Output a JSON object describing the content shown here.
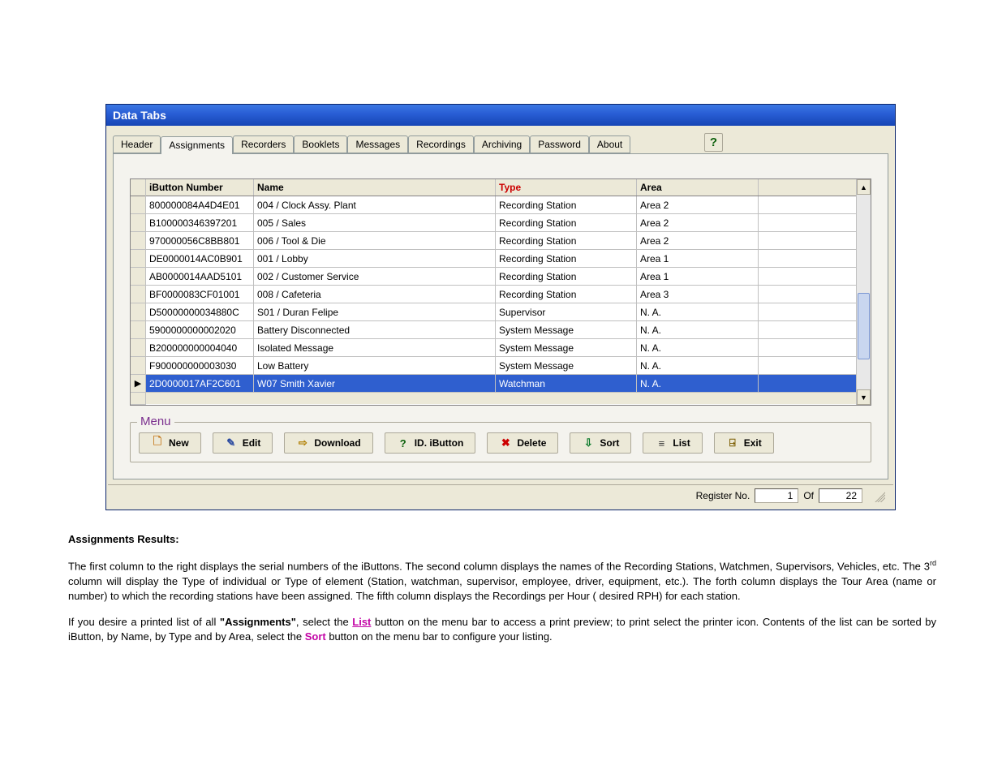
{
  "window": {
    "title": "Data Tabs",
    "help_icon": "?"
  },
  "tabs": {
    "items": [
      "Header",
      "Assignments",
      "Recorders",
      "Booklets",
      "Messages",
      "Recordings",
      "Archiving",
      "Password",
      "About"
    ],
    "active_index": 1
  },
  "grid": {
    "headers": {
      "ibutton": "iButton Number",
      "name": "Name",
      "type": "Type",
      "area": "Area"
    },
    "rows": [
      {
        "ibutton": "800000084A4D4E01",
        "name": "004 / Clock Assy. Plant",
        "type": "Recording Station",
        "area": "Area 2",
        "selected": false
      },
      {
        "ibutton": "B100000346397201",
        "name": "005 / Sales",
        "type": "Recording Station",
        "area": "Area 2",
        "selected": false
      },
      {
        "ibutton": "970000056C8BB801",
        "name": "006 / Tool & Die",
        "type": "Recording Station",
        "area": "Area 2",
        "selected": false
      },
      {
        "ibutton": "DE0000014AC0B901",
        "name": "001 / Lobby",
        "type": "Recording Station",
        "area": "Area 1",
        "selected": false
      },
      {
        "ibutton": "AB0000014AAD5101",
        "name": "002 / Customer Service",
        "type": "Recording Station",
        "area": "Area 1",
        "selected": false
      },
      {
        "ibutton": "BF0000083CF01001",
        "name": "008 / Cafeteria",
        "type": "Recording Station",
        "area": "Area 3",
        "selected": false
      },
      {
        "ibutton": "D50000000034880C",
        "name": "S01 / Duran Felipe",
        "type": "Supervisor",
        "area": "N. A.",
        "selected": false
      },
      {
        "ibutton": "5900000000002020",
        "name": "Battery Disconnected",
        "type": "System Message",
        "area": "N. A.",
        "selected": false
      },
      {
        "ibutton": "B200000000004040",
        "name": "Isolated Message",
        "type": "System Message",
        "area": "N. A.",
        "selected": false
      },
      {
        "ibutton": "F900000000003030",
        "name": "Low Battery",
        "type": "System Message",
        "area": "N. A.",
        "selected": false
      },
      {
        "ibutton": "2D0000017AF2C601",
        "name": "W07 Smith Xavier",
        "type": "Watchman",
        "area": "N. A.",
        "selected": true
      }
    ]
  },
  "menu": {
    "legend": "Menu",
    "buttons": {
      "new": "New",
      "edit": "Edit",
      "download": "Download",
      "id_ibutton": "ID. iButton",
      "delete": "Delete",
      "sort": "Sort",
      "list": "List",
      "exit": "Exit"
    }
  },
  "status": {
    "label": "Register No.",
    "current": "1",
    "of_label": "Of",
    "total": "22"
  },
  "doc": {
    "heading": "Assignments Results:",
    "p1a": "The first column to the right displays the serial numbers of the iButtons. The second column displays the names of the Recording Stations, Watchmen, Supervisors, Vehicles, etc. The 3",
    "p1_sup": "rd",
    "p1b": " column will display the Type of individual or Type of element (Station, watchman, supervisor, employee, driver, equipment, etc.). The forth column displays the Tour Area (name or number) to which the recording stations have been assigned. The fifth column displays the Recordings per Hour ( desired RPH) for each station.",
    "p2a": "If you desire a printed list of all ",
    "p2_kw1": "\"Assignments\"",
    "p2b": ", select the ",
    "p2_list": "List",
    "p2c": " button on the menu bar to access a print preview; to print select the printer icon. Contents of the list can be sorted by iButton, by Name, by Type and by Area, select the ",
    "p2_sort": "Sort",
    "p2d": " button on the menu bar to configure your listing."
  },
  "colors": {
    "titlebar_top": "#3b77e3",
    "selection": "#2f5fcf",
    "type_header": "#cc0000",
    "link": "#c305a6",
    "menu_legend": "#7a2e8e"
  }
}
